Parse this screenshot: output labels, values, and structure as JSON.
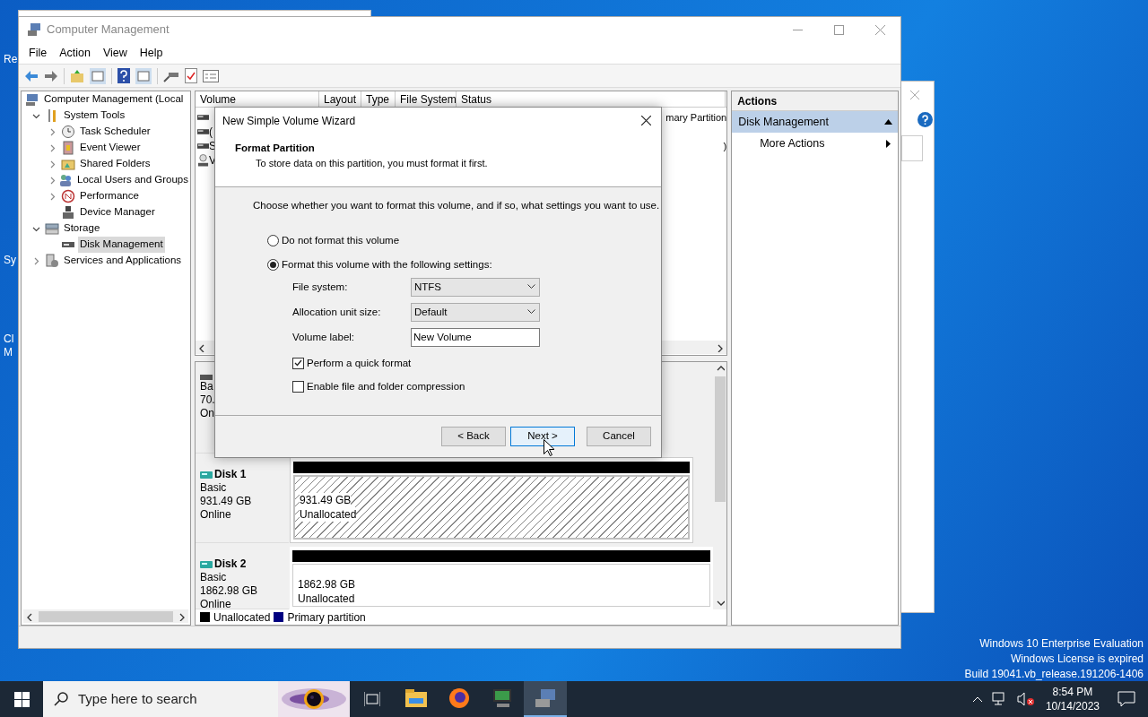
{
  "desktop": {
    "icon_labels": [
      "Re",
      "Sy",
      "Cl",
      "M"
    ],
    "notice_lines": [
      "Windows 10 Enterprise Evaluation",
      "Windows License is expired",
      "Build 19041.vb_release.191206-1406"
    ]
  },
  "window": {
    "title": "Computer Management",
    "menu": [
      "File",
      "Action",
      "View",
      "Help"
    ],
    "tree": [
      {
        "label": "Computer Management (Local",
        "expandable": false,
        "expanded": true,
        "selected": false,
        "children": [
          {
            "label": "System Tools",
            "expandable": true,
            "expanded": true,
            "selected": false,
            "children": [
              {
                "label": "Task Scheduler",
                "expandable": true,
                "expanded": false,
                "selected": false
              },
              {
                "label": "Event Viewer",
                "expandable": true,
                "expanded": false,
                "selected": false
              },
              {
                "label": "Shared Folders",
                "expandable": true,
                "expanded": false,
                "selected": false
              },
              {
                "label": "Local Users and Groups",
                "expandable": true,
                "expanded": false,
                "selected": false
              },
              {
                "label": "Performance",
                "expandable": true,
                "expanded": false,
                "selected": false
              },
              {
                "label": "Device Manager",
                "expandable": false,
                "expanded": false,
                "selected": false
              }
            ]
          },
          {
            "label": "Storage",
            "expandable": true,
            "expanded": true,
            "selected": false,
            "children": [
              {
                "label": "Disk Management",
                "expandable": false,
                "expanded": false,
                "selected": true
              }
            ]
          },
          {
            "label": "Services and Applications",
            "expandable": true,
            "expanded": false,
            "selected": false
          }
        ]
      }
    ],
    "volume_table": {
      "columns": [
        "Volume",
        "Layout",
        "Type",
        "File System",
        "Status"
      ],
      "rows": [
        {
          "kind": "drive",
          "status": "mary Partition"
        },
        {
          "kind": "drive",
          "volume": "("
        },
        {
          "kind": "drive",
          "volume": "S",
          "status": ")"
        },
        {
          "kind": "cd",
          "volume": "V"
        }
      ]
    },
    "disks": [
      {
        "lines": [
          "Ba",
          "70.",
          "On"
        ]
      },
      {
        "name": "Disk 1",
        "type": "Basic",
        "size": "931.49 GB",
        "status": "Online",
        "partition": {
          "size": "931.49 GB",
          "label": "Unallocated",
          "color": "#000000",
          "selected": true
        }
      },
      {
        "name": "Disk 2",
        "type": "Basic",
        "size": "1862.98 GB",
        "status": "Online",
        "partition": {
          "size": "1862.98 GB",
          "label": "Unallocated",
          "color": "#000000",
          "selected": false
        }
      }
    ],
    "legend": [
      {
        "label": "Unallocated",
        "color": "#000000"
      },
      {
        "label": "Primary partition",
        "color": "#000080"
      }
    ],
    "actions": {
      "title": "Actions",
      "section": "Disk Management",
      "expanded": true,
      "items": [
        "More Actions"
      ]
    }
  },
  "dialog": {
    "title": "New Simple Volume Wizard",
    "heading": "Format Partition",
    "subheading": "To store data on this partition, you must format it first.",
    "prompt": "Choose whether you want to format this volume, and if so, what settings you want to use.",
    "options": [
      {
        "label": "Do not format this volume",
        "selected": false
      },
      {
        "label": "Format this volume with the following settings:",
        "selected": true
      }
    ],
    "fields": [
      {
        "kind": "select",
        "label": "File system:",
        "value": "NTFS"
      },
      {
        "kind": "select",
        "label": "Allocation unit size:",
        "value": "Default"
      },
      {
        "kind": "text",
        "label": "Volume label:",
        "value": "New Volume"
      }
    ],
    "checkboxes": [
      {
        "label": "Perform a quick format",
        "checked": true
      },
      {
        "label": "Enable file and folder compression",
        "checked": false
      }
    ],
    "buttons": [
      {
        "label": "< Back",
        "focused": false
      },
      {
        "label": "Next >",
        "focused": true
      },
      {
        "label": "Cancel",
        "focused": false
      }
    ]
  },
  "taskbar": {
    "search_placeholder": "Type here to search",
    "apps": [
      {
        "kind": "explorer",
        "active": false
      },
      {
        "kind": "browser",
        "active": false
      },
      {
        "kind": "monitor",
        "active": false
      },
      {
        "kind": "management",
        "active": true
      }
    ],
    "time": "8:54 PM",
    "date": "10/14/2023"
  }
}
